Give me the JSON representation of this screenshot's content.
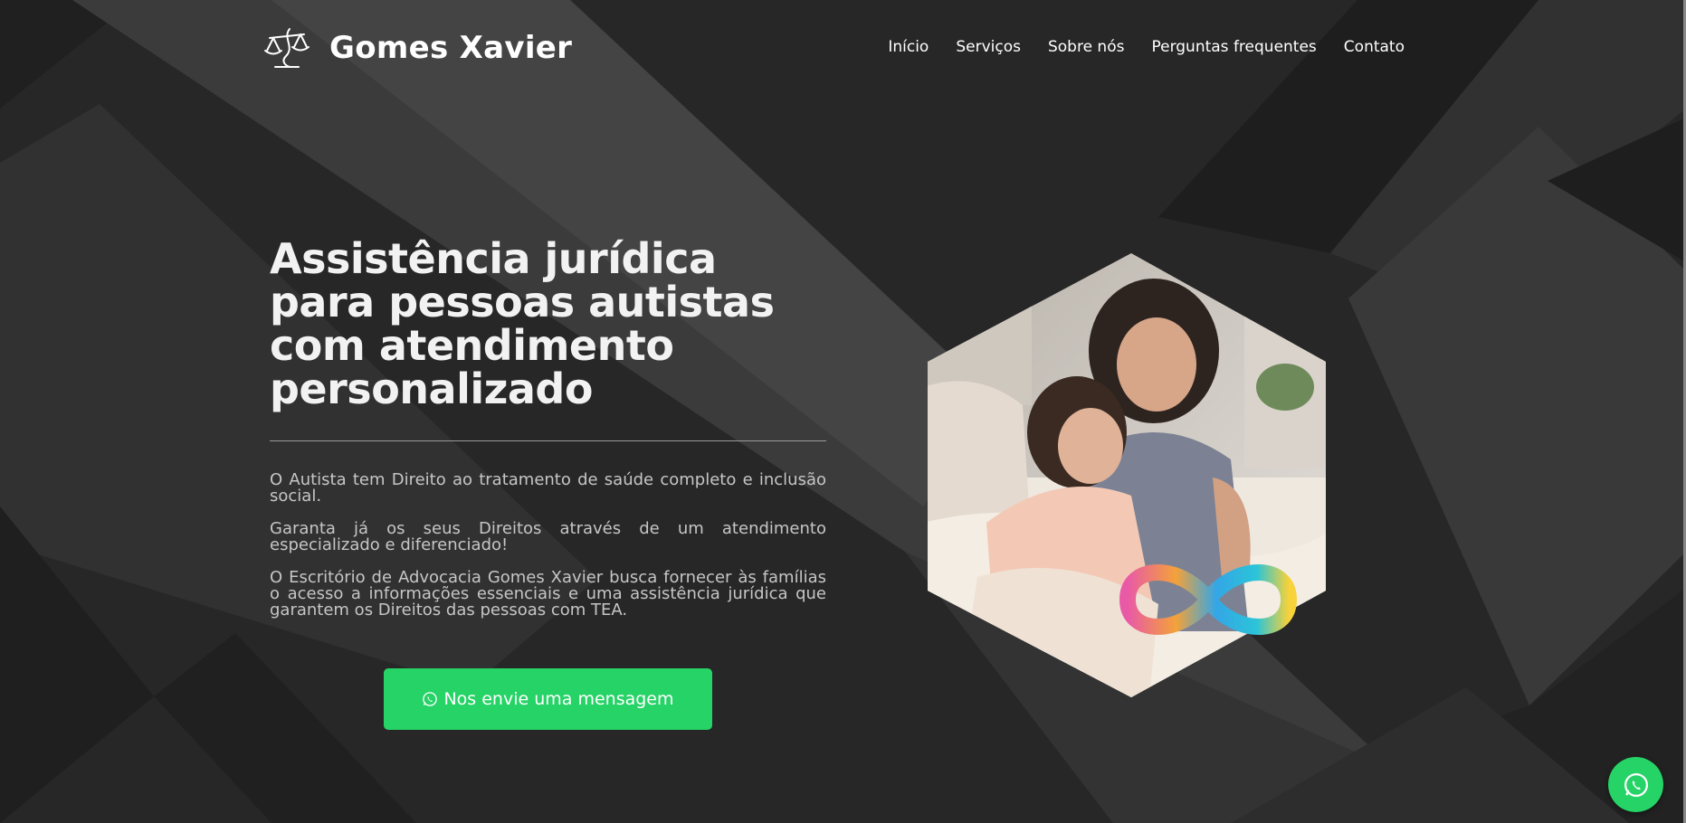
{
  "brand": {
    "name": "Gomes Xavier",
    "logo_icon": "scales-of-justice-icon"
  },
  "nav": {
    "items": [
      {
        "label": "Início"
      },
      {
        "label": "Serviços"
      },
      {
        "label": "Sobre nós"
      },
      {
        "label": "Perguntas frequentes"
      },
      {
        "label": "Contato"
      }
    ]
  },
  "hero": {
    "title": "Assistência jurídica para pessoas autistas com atendimento personalizado",
    "paragraphs": [
      "O Autista tem Direito ao tratamento de saúde completo e inclusão social.",
      "Garanta já os seus Direitos através de um atendimento especializado e diferenciado!",
      "O Escritório de Advocacia Gomes Xavier busca fornecer às famílias o acesso a informações essenciais e uma assistência jurídica que garantem os Direitos das pessoas com TEA."
    ],
    "cta_label": "Nos envie uma mensagem",
    "cta_icon": "whatsapp-icon",
    "image": {
      "subject": "mother-hugging-daughter-photo",
      "badge_icon": "rainbow-infinity-icon"
    }
  },
  "floating_button": {
    "icon": "whatsapp-icon"
  },
  "colors": {
    "accent": "#25d366",
    "background": "#262626",
    "text": "#ffffff"
  }
}
